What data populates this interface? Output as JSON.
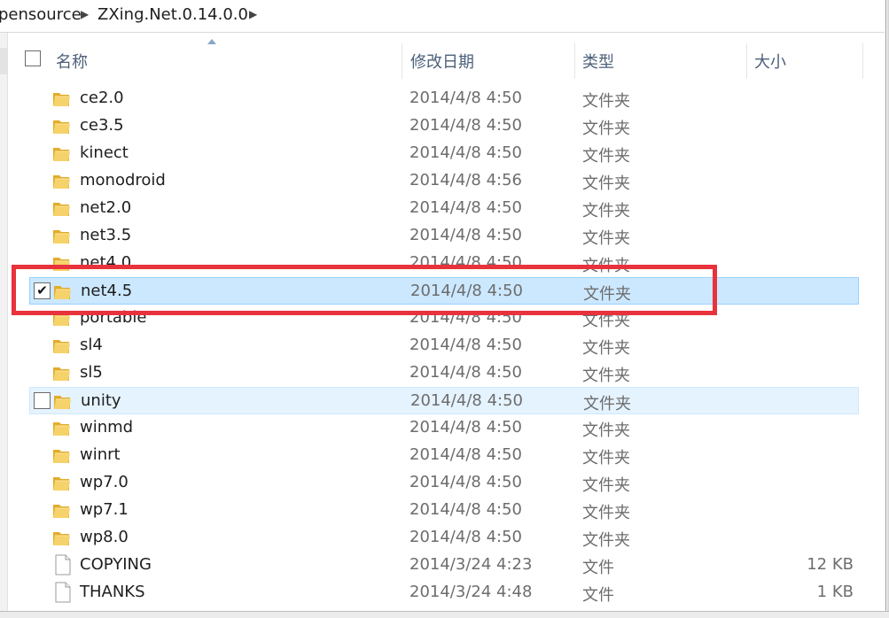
{
  "breadcrumb": {
    "items": [
      "pensource",
      "ZXing.Net.0.14.0.0"
    ]
  },
  "columns": {
    "name": "名称",
    "date": "修改日期",
    "type": "类型",
    "size": "大小"
  },
  "files": [
    {
      "name": "ce2.0",
      "date": "2014/4/8 4:50",
      "type": "文件夹",
      "size": "",
      "icon": "folder-icon",
      "state": "normal"
    },
    {
      "name": "ce3.5",
      "date": "2014/4/8 4:50",
      "type": "文件夹",
      "size": "",
      "icon": "folder-icon",
      "state": "normal"
    },
    {
      "name": "kinect",
      "date": "2014/4/8 4:50",
      "type": "文件夹",
      "size": "",
      "icon": "folder-icon",
      "state": "normal"
    },
    {
      "name": "monodroid",
      "date": "2014/4/8 4:56",
      "type": "文件夹",
      "size": "",
      "icon": "folder-icon",
      "state": "normal"
    },
    {
      "name": "net2.0",
      "date": "2014/4/8 4:50",
      "type": "文件夹",
      "size": "",
      "icon": "folder-icon",
      "state": "normal"
    },
    {
      "name": "net3.5",
      "date": "2014/4/8 4:50",
      "type": "文件夹",
      "size": "",
      "icon": "folder-icon",
      "state": "normal"
    },
    {
      "name": "net4.0",
      "date": "2014/4/8 4:50",
      "type": "文件夹",
      "size": "",
      "icon": "folder-icon",
      "state": "normal"
    },
    {
      "name": "net4.5",
      "date": "2014/4/8 4:50",
      "type": "文件夹",
      "size": "",
      "icon": "folder-icon",
      "state": "selected",
      "checked": true
    },
    {
      "name": "portable",
      "date": "2014/4/8 4:50",
      "type": "文件夹",
      "size": "",
      "icon": "folder-icon",
      "state": "normal"
    },
    {
      "name": "sl4",
      "date": "2014/4/8 4:50",
      "type": "文件夹",
      "size": "",
      "icon": "folder-icon",
      "state": "normal"
    },
    {
      "name": "sl5",
      "date": "2014/4/8 4:50",
      "type": "文件夹",
      "size": "",
      "icon": "folder-icon",
      "state": "normal"
    },
    {
      "name": "unity",
      "date": "2014/4/8 4:50",
      "type": "文件夹",
      "size": "",
      "icon": "folder-icon",
      "state": "hover",
      "checked": false
    },
    {
      "name": "winmd",
      "date": "2014/4/8 4:50",
      "type": "文件夹",
      "size": "",
      "icon": "folder-icon",
      "state": "normal"
    },
    {
      "name": "winrt",
      "date": "2014/4/8 4:50",
      "type": "文件夹",
      "size": "",
      "icon": "folder-icon",
      "state": "normal"
    },
    {
      "name": "wp7.0",
      "date": "2014/4/8 4:50",
      "type": "文件夹",
      "size": "",
      "icon": "folder-icon",
      "state": "normal"
    },
    {
      "name": "wp7.1",
      "date": "2014/4/8 4:50",
      "type": "文件夹",
      "size": "",
      "icon": "folder-icon",
      "state": "normal"
    },
    {
      "name": "wp8.0",
      "date": "2014/4/8 4:50",
      "type": "文件夹",
      "size": "",
      "icon": "folder-icon",
      "state": "normal"
    },
    {
      "name": "COPYING",
      "date": "2014/3/24 4:23",
      "type": "文件",
      "size": "12 KB",
      "icon": "file-icon",
      "state": "normal"
    },
    {
      "name": "THANKS",
      "date": "2014/3/24 4:48",
      "type": "文件",
      "size": "1 KB",
      "icon": "file-icon",
      "state": "normal"
    }
  ],
  "colors": {
    "selected_bg": "#cce8ff",
    "hover_bg": "#e5f3ff",
    "annotation_red": "#e8323c",
    "folder_yellow": "#f4c842"
  }
}
